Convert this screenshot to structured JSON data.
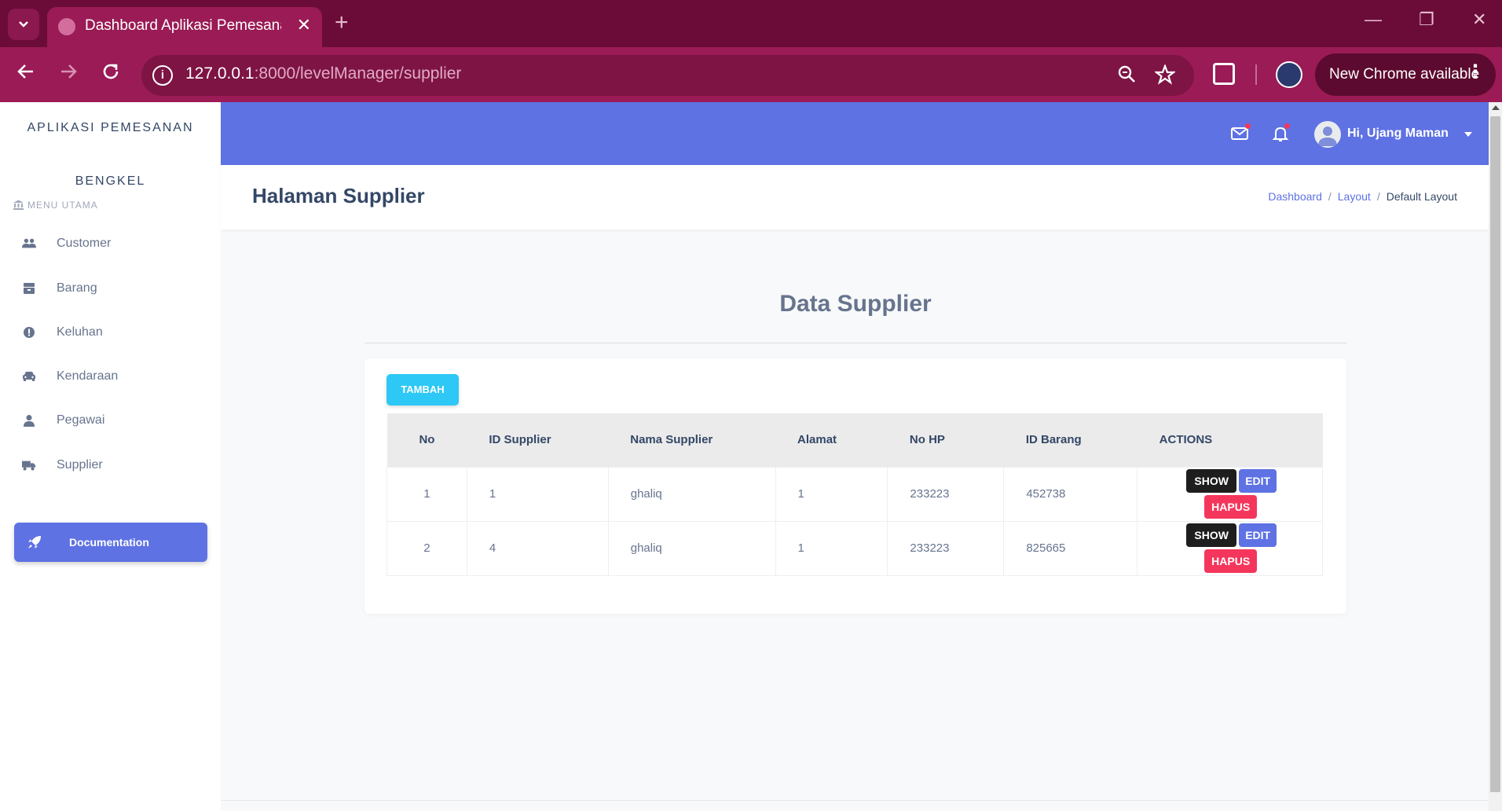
{
  "browser": {
    "tab_title": "Dashboard Aplikasi Pemesanan",
    "url_host": "127.0.0.1",
    "url_path": ":8000/levelManager/supplier",
    "update_label": "New Chrome available"
  },
  "sidebar": {
    "brand_line1": "APLIKASI PEMESANAN",
    "brand_line2": "BENGKEL",
    "menu_heading": "MENU UTAMA",
    "items": [
      {
        "label": "Customer",
        "icon": "users-icon"
      },
      {
        "label": "Barang",
        "icon": "box-icon"
      },
      {
        "label": "Keluhan",
        "icon": "alert-icon"
      },
      {
        "label": "Kendaraan",
        "icon": "car-icon"
      },
      {
        "label": "Pegawai",
        "icon": "user-icon"
      },
      {
        "label": "Supplier",
        "icon": "truck-icon"
      }
    ],
    "documentation_label": "Documentation"
  },
  "topnav": {
    "user_greeting": "Hi, Ujang Maman"
  },
  "header": {
    "page_title": "Halaman Supplier",
    "breadcrumb": [
      "Dashboard",
      "Layout",
      "Default Layout"
    ]
  },
  "main": {
    "section_title": "Data Supplier",
    "add_button": "TAMBAH",
    "table": {
      "columns": [
        "No",
        "ID Supplier",
        "Nama Supplier",
        "Alamat",
        "No HP",
        "ID Barang",
        "ACTIONS"
      ],
      "rows": [
        {
          "no": "1",
          "id_supplier": "1",
          "nama": "ghaliq",
          "alamat": "1",
          "no_hp": "233223",
          "id_barang": "452738"
        },
        {
          "no": "2",
          "id_supplier": "4",
          "nama": "ghaliq",
          "alamat": "1",
          "no_hp": "233223",
          "id_barang": "825665"
        }
      ],
      "actions": {
        "show": "SHOW",
        "edit": "EDIT",
        "hapus": "HAPUS"
      }
    }
  },
  "colors": {
    "accent": "#5e72e4",
    "info": "#2dc8f5",
    "danger": "#f5365c",
    "dark": "#1e1e1e",
    "chrome_frame": "#6b0c38",
    "chrome_toolbar": "#9a1b55"
  }
}
